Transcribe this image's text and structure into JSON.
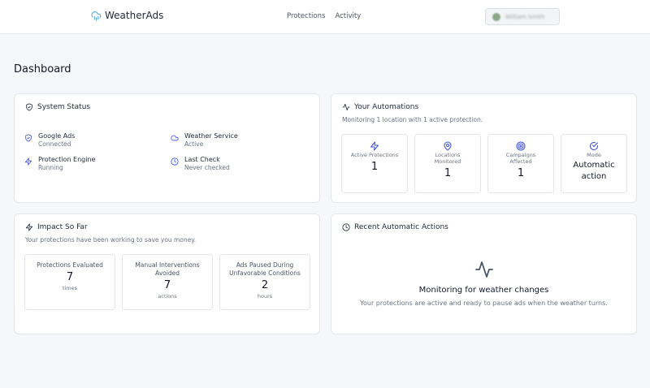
{
  "header": {
    "app_name": "WeatherAds",
    "nav": [
      "Protections",
      "Activity"
    ],
    "account_name": "William Smith"
  },
  "page": {
    "title": "Dashboard"
  },
  "system_status": {
    "title": "System Status",
    "items": [
      {
        "label": "Google Ads",
        "value": "Connected",
        "icon": "shield-icon"
      },
      {
        "label": "Weather Service",
        "value": "Active",
        "icon": "cloud-icon"
      },
      {
        "label": "Protection Engine",
        "value": "Running",
        "icon": "bolt-icon"
      },
      {
        "label": "Last Check",
        "value": "Never checked",
        "icon": "clock-icon"
      }
    ]
  },
  "automations": {
    "title": "Your Automations",
    "subtitle": "Monitoring 1 location with 1 active protection.",
    "stats": [
      {
        "label": "Active Protections",
        "value": "1",
        "icon": "bolt-icon"
      },
      {
        "label": "Locations Monitored",
        "value": "1",
        "icon": "map-pin-icon"
      },
      {
        "label": "Campaigns Affected",
        "value": "1",
        "icon": "target-icon"
      },
      {
        "label": "Mode",
        "value": "Automatic action",
        "icon": "check-circle-icon"
      }
    ]
  },
  "impact": {
    "title": "Impact So Far",
    "subtitle": "Your protections have been working to save you money.",
    "stats": [
      {
        "label": "Protections Evaluated",
        "value": "7",
        "unit": "times"
      },
      {
        "label": "Manual Interventions Avoided",
        "value": "7",
        "unit": "actions"
      },
      {
        "label": "Ads Paused During Unfavorable Conditions",
        "value": "2",
        "unit": "hours"
      }
    ]
  },
  "recent": {
    "title": "Recent Automatic Actions",
    "empty_title": "Monitoring for weather changes",
    "empty_text": "Your protections are active and ready to pause ads when the weather turns."
  },
  "colors": {
    "accent": "#3b4fd8",
    "brand": "#5aa9e6",
    "text": "#1f2937",
    "muted": "#6b7280"
  }
}
